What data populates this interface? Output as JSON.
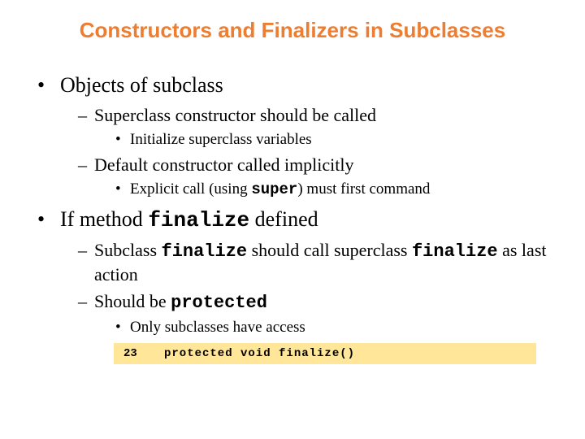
{
  "title": "Constructors and Finalizers in Subclasses",
  "b1": {
    "text": "Objects of subclass",
    "s1": {
      "text": "Superclass constructor should be called",
      "t1": "Initialize superclass variables"
    },
    "s2": {
      "text": "Default constructor called implicitly",
      "t1_a": "Explicit call (using ",
      "t1_code": "super",
      "t1_b": ") must first command"
    }
  },
  "b2": {
    "text_a": "If method ",
    "text_code": "finalize",
    "text_b": " defined",
    "s1": {
      "a": "Subclass ",
      "code1": "finalize",
      "b": " should call superclass ",
      "code2": "finalize",
      "c": " as last action"
    },
    "s2": {
      "a": "Should be ",
      "code": "protected",
      "t1": "Only subclasses have access"
    }
  },
  "code": {
    "line": "23",
    "text": "protected void finalize()"
  }
}
